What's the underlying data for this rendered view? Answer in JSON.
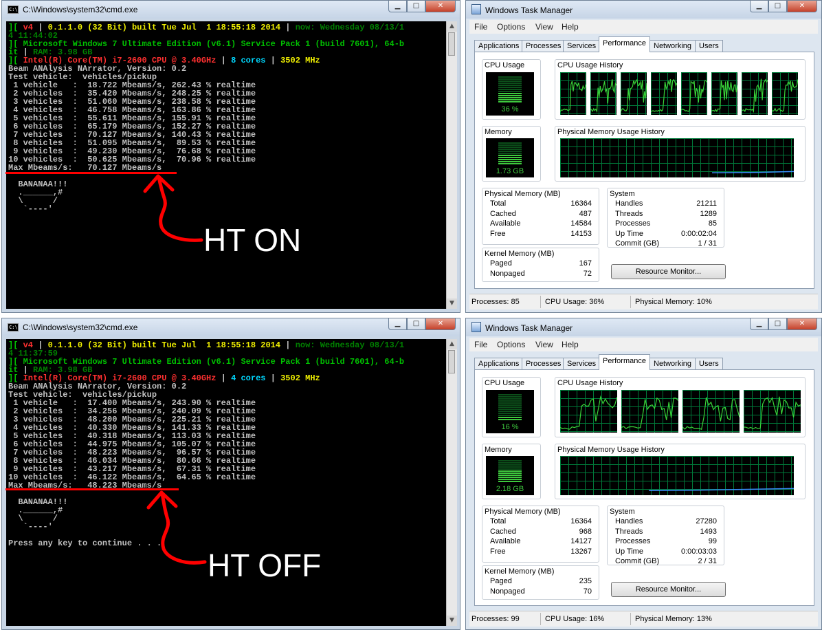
{
  "cmd_top": {
    "title": "C:\\Windows\\system32\\cmd.exe",
    "icon": "cmd-icon",
    "lines": [
      [
        {
          "t": "][ ",
          "c": "g"
        },
        {
          "t": "v4",
          "c": "r"
        },
        {
          "t": " | ",
          "c": "w"
        },
        {
          "t": "0.1.1.0 (32 Bit) built Tue Jul  1 18:55:18 2014",
          "c": "y"
        },
        {
          "t": " | ",
          "c": "w"
        },
        {
          "t": "now: Wednesday 08/13/1",
          "c": "dg"
        }
      ],
      [
        {
          "t": "4 11:44:02",
          "c": "dg"
        }
      ],
      [
        {
          "t": "][ ",
          "c": "g"
        },
        {
          "t": "Microsoft Windows 7 Ultimate Edition (v6.1) Service Pack 1 (build 7601), 64-b",
          "c": "g"
        }
      ],
      [
        {
          "t": "it",
          "c": "g"
        },
        {
          "t": " | ",
          "c": "w"
        },
        {
          "t": "RAM: 3.98 GB",
          "c": "dg"
        }
      ],
      [
        {
          "t": "][ ",
          "c": "g"
        },
        {
          "t": "Intel(R) Core(TM) i7-2600 CPU @ 3.40GHz",
          "c": "r"
        },
        {
          "t": " | ",
          "c": "w"
        },
        {
          "t": "8 cores",
          "c": "c"
        },
        {
          "t": " | ",
          "c": "w"
        },
        {
          "t": "3502 MHz",
          "c": "y"
        }
      ],
      [
        {
          "t": "Beam ANAlysis NArrator, Version: 0.2",
          "c": "w"
        }
      ],
      [
        {
          "t": "Test vehicle:  vehicles/pickup",
          "c": "w"
        }
      ],
      [
        {
          "t": " 1 vehicle   :  18.722 Mbeams/s, 262.43 % realtime",
          "c": "w"
        }
      ],
      [
        {
          "t": " 2 vehicles  :  35.420 Mbeams/s, 248.25 % realtime",
          "c": "w"
        }
      ],
      [
        {
          "t": " 3 vehicles  :  51.060 Mbeams/s, 238.58 % realtime",
          "c": "w"
        }
      ],
      [
        {
          "t": " 4 vehicles  :  46.758 Mbeams/s, 163.86 % realtime",
          "c": "w"
        }
      ],
      [
        {
          "t": " 5 vehicles  :  55.611 Mbeams/s, 155.91 % realtime",
          "c": "w"
        }
      ],
      [
        {
          "t": " 6 vehicles  :  65.179 Mbeams/s, 152.27 % realtime",
          "c": "w"
        }
      ],
      [
        {
          "t": " 7 vehicles  :  70.127 Mbeams/s, 140.43 % realtime",
          "c": "w"
        }
      ],
      [
        {
          "t": " 8 vehicles  :  51.095 Mbeams/s,  89.53 % realtime",
          "c": "w"
        }
      ],
      [
        {
          "t": " 9 vehicles  :  49.230 Mbeams/s,  76.68 % realtime",
          "c": "w"
        }
      ],
      [
        {
          "t": "10 vehicles  :  50.625 Mbeams/s,  70.96 % realtime",
          "c": "w"
        }
      ],
      [
        {
          "t": "Max Mbeams/s:   70.127 Mbeams/s",
          "c": "w"
        }
      ],
      [
        {
          "t": "",
          "c": "w"
        }
      ],
      [
        {
          "t": "  BANANAA!!!",
          "c": "w"
        }
      ],
      [
        {
          "t": "  .______,#",
          "c": "w"
        }
      ],
      [
        {
          "t": "  \\      /",
          "c": "w"
        }
      ],
      [
        {
          "t": "   `----'",
          "c": "w"
        }
      ]
    ],
    "annotation": "HT ON"
  },
  "cmd_bottom": {
    "title": "C:\\Windows\\system32\\cmd.exe",
    "icon": "cmd-icon",
    "lines": [
      [
        {
          "t": "][ ",
          "c": "g"
        },
        {
          "t": "v4",
          "c": "r"
        },
        {
          "t": " | ",
          "c": "w"
        },
        {
          "t": "0.1.1.0 (32 Bit) built Tue Jul  1 18:55:18 2014",
          "c": "y"
        },
        {
          "t": " | ",
          "c": "w"
        },
        {
          "t": "now: Wednesday 08/13/1",
          "c": "dg"
        }
      ],
      [
        {
          "t": "4 11:37:59",
          "c": "dg"
        }
      ],
      [
        {
          "t": "][ ",
          "c": "g"
        },
        {
          "t": "Microsoft Windows 7 Ultimate Edition (v6.1) Service Pack 1 (build 7601), 64-b",
          "c": "g"
        }
      ],
      [
        {
          "t": "it",
          "c": "g"
        },
        {
          "t": " | ",
          "c": "w"
        },
        {
          "t": "RAM: 3.98 GB",
          "c": "dg"
        }
      ],
      [
        {
          "t": "][ ",
          "c": "g"
        },
        {
          "t": "Intel(R) Core(TM) i7-2600 CPU @ 3.40GHz",
          "c": "r"
        },
        {
          "t": " | ",
          "c": "w"
        },
        {
          "t": "4 cores",
          "c": "c"
        },
        {
          "t": " | ",
          "c": "w"
        },
        {
          "t": "3502 MHz",
          "c": "y"
        }
      ],
      [
        {
          "t": "Beam ANAlysis NArrator, Version: 0.2",
          "c": "w"
        }
      ],
      [
        {
          "t": "Test vehicle:  vehicles/pickup",
          "c": "w"
        }
      ],
      [
        {
          "t": " 1 vehicle   :  17.400 Mbeams/s, 243.90 % realtime",
          "c": "w"
        }
      ],
      [
        {
          "t": " 2 vehicles  :  34.256 Mbeams/s, 240.09 % realtime",
          "c": "w"
        }
      ],
      [
        {
          "t": " 3 vehicles  :  48.200 Mbeams/s, 225.21 % realtime",
          "c": "w"
        }
      ],
      [
        {
          "t": " 4 vehicles  :  40.330 Mbeams/s, 141.33 % realtime",
          "c": "w"
        }
      ],
      [
        {
          "t": " 5 vehicles  :  40.318 Mbeams/s, 113.03 % realtime",
          "c": "w"
        }
      ],
      [
        {
          "t": " 6 vehicles  :  44.975 Mbeams/s, 105.07 % realtime",
          "c": "w"
        }
      ],
      [
        {
          "t": " 7 vehicles  :  48.223 Mbeams/s,  96.57 % realtime",
          "c": "w"
        }
      ],
      [
        {
          "t": " 8 vehicles  :  46.034 Mbeams/s,  80.66 % realtime",
          "c": "w"
        }
      ],
      [
        {
          "t": " 9 vehicles  :  43.217 Mbeams/s,  67.31 % realtime",
          "c": "w"
        }
      ],
      [
        {
          "t": "10 vehicles  :  46.122 Mbeams/s,  64.65 % realtime",
          "c": "w"
        }
      ],
      [
        {
          "t": "Max Mbeams/s:   48.223 Mbeams/s",
          "c": "w"
        }
      ],
      [
        {
          "t": "",
          "c": "w"
        }
      ],
      [
        {
          "t": "  BANANAA!!!",
          "c": "w"
        }
      ],
      [
        {
          "t": "  .______,#",
          "c": "w"
        }
      ],
      [
        {
          "t": "  \\      /",
          "c": "w"
        }
      ],
      [
        {
          "t": "   `----'",
          "c": "w"
        }
      ],
      [
        {
          "t": "",
          "c": "w"
        }
      ],
      [
        {
          "t": "Press any key to continue . . .",
          "c": "w"
        }
      ]
    ],
    "annotation": "HT OFF"
  },
  "tm_top": {
    "title": "Windows Task Manager",
    "menu": [
      "File",
      "Options",
      "View",
      "Help"
    ],
    "tabs": [
      "Applications",
      "Processes",
      "Services",
      "Performance",
      "Networking",
      "Users"
    ],
    "active_tab": "Performance",
    "cpu_usage_label": "CPU Usage",
    "cpu_usage_value": "36 %",
    "cpu_usage_fraction": 0.36,
    "cpu_history_label": "CPU Usage History",
    "cpu_cores_shown": 8,
    "memory_label": "Memory",
    "memory_value": "1.73 GB",
    "memory_fraction": 0.42,
    "phys_history_label": "Physical Memory Usage History",
    "physical_memory": {
      "title": "Physical Memory (MB)",
      "rows": [
        [
          "Total",
          "16364"
        ],
        [
          "Cached",
          "487"
        ],
        [
          "Available",
          "14584"
        ],
        [
          "Free",
          "14153"
        ]
      ]
    },
    "kernel_memory": {
      "title": "Kernel Memory (MB)",
      "rows": [
        [
          "Paged",
          "167"
        ],
        [
          "Nonpaged",
          "72"
        ]
      ]
    },
    "system": {
      "title": "System",
      "rows": [
        [
          "Handles",
          "21211"
        ],
        [
          "Threads",
          "1289"
        ],
        [
          "Processes",
          "85"
        ],
        [
          "Up Time",
          "0:00:02:04"
        ],
        [
          "Commit (GB)",
          "1 / 31"
        ]
      ]
    },
    "resource_monitor_button": "Resource Monitor...",
    "status": {
      "processes": "Processes: 85",
      "cpu": "CPU Usage: 36%",
      "memory": "Physical Memory: 10%"
    }
  },
  "tm_bottom": {
    "title": "Windows Task Manager",
    "menu": [
      "File",
      "Options",
      "View",
      "Help"
    ],
    "tabs": [
      "Applications",
      "Processes",
      "Services",
      "Performance",
      "Networking",
      "Users"
    ],
    "active_tab": "Performance",
    "cpu_usage_label": "CPU Usage",
    "cpu_usage_value": "16 %",
    "cpu_usage_fraction": 0.16,
    "cpu_history_label": "CPU Usage History",
    "cpu_cores_shown": 4,
    "memory_label": "Memory",
    "memory_value": "2.18 GB",
    "memory_fraction": 0.55,
    "phys_history_label": "Physical Memory Usage History",
    "physical_memory": {
      "title": "Physical Memory (MB)",
      "rows": [
        [
          "Total",
          "16364"
        ],
        [
          "Cached",
          "968"
        ],
        [
          "Available",
          "14127"
        ],
        [
          "Free",
          "13267"
        ]
      ]
    },
    "kernel_memory": {
      "title": "Kernel Memory (MB)",
      "rows": [
        [
          "Paged",
          "235"
        ],
        [
          "Nonpaged",
          "70"
        ]
      ]
    },
    "system": {
      "title": "System",
      "rows": [
        [
          "Handles",
          "27280"
        ],
        [
          "Threads",
          "1493"
        ],
        [
          "Processes",
          "99"
        ],
        [
          "Up Time",
          "0:00:03:03"
        ],
        [
          "Commit (GB)",
          "2 / 31"
        ]
      ]
    },
    "resource_monitor_button": "Resource Monitor...",
    "status": {
      "processes": "Processes: 99",
      "cpu": "CPU Usage: 16%",
      "memory": "Physical Memory: 13%"
    }
  },
  "colors": {
    "console_bg": "#000000",
    "console_text": "#c0c0c0",
    "graph_line": "#39d439",
    "graph_grid": "#007a3a",
    "annotation_red": "#ff0000",
    "memory_line": "#3a8fff"
  },
  "control_glyphs": {
    "minimize": "▁",
    "maximize": "□",
    "close": "✕",
    "scroll_up": "▲",
    "scroll_down": "▼"
  }
}
